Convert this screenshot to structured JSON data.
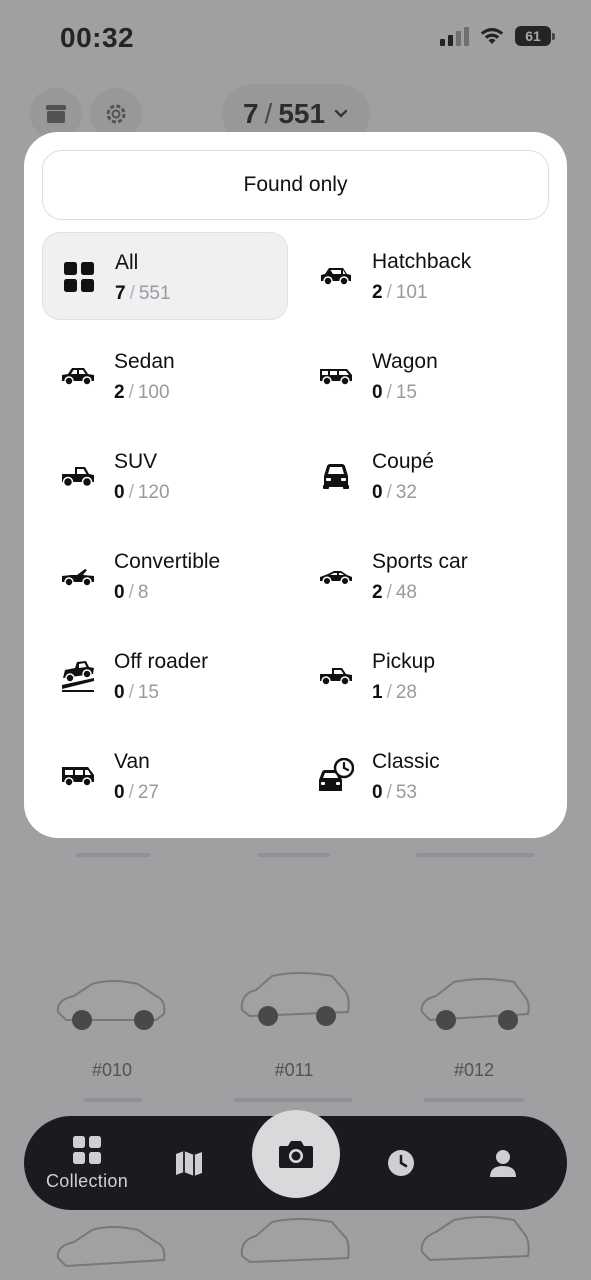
{
  "status_bar": {
    "time": "00:32",
    "battery": "61"
  },
  "header": {
    "found": "7",
    "total": "551",
    "separator": "/"
  },
  "background_cards": [
    {
      "label": "#010"
    },
    {
      "label": "#011"
    },
    {
      "label": "#012"
    }
  ],
  "popup": {
    "found_only_label": "Found only",
    "categories": [
      {
        "name": "All",
        "found": "7",
        "total": "551",
        "icon": "grid-icon",
        "selected": true
      },
      {
        "name": "Hatchback",
        "found": "2",
        "total": "101",
        "icon": "hatchback-icon"
      },
      {
        "name": "Sedan",
        "found": "2",
        "total": "100",
        "icon": "sedan-icon"
      },
      {
        "name": "Wagon",
        "found": "0",
        "total": "15",
        "icon": "wagon-icon"
      },
      {
        "name": "SUV",
        "found": "0",
        "total": "120",
        "icon": "suv-icon"
      },
      {
        "name": "Coupé",
        "found": "0",
        "total": "32",
        "icon": "coupe-icon"
      },
      {
        "name": "Convertible",
        "found": "0",
        "total": "8",
        "icon": "convertible-icon"
      },
      {
        "name": "Sports car",
        "found": "2",
        "total": "48",
        "icon": "sports-car-icon"
      },
      {
        "name": "Off roader",
        "found": "0",
        "total": "15",
        "icon": "off-roader-icon"
      },
      {
        "name": "Pickup",
        "found": "1",
        "total": "28",
        "icon": "pickup-icon"
      },
      {
        "name": "Van",
        "found": "0",
        "total": "27",
        "icon": "van-icon"
      },
      {
        "name": "Classic",
        "found": "0",
        "total": "53",
        "icon": "classic-icon"
      }
    ]
  },
  "nav": {
    "collection_label": "Collection"
  }
}
